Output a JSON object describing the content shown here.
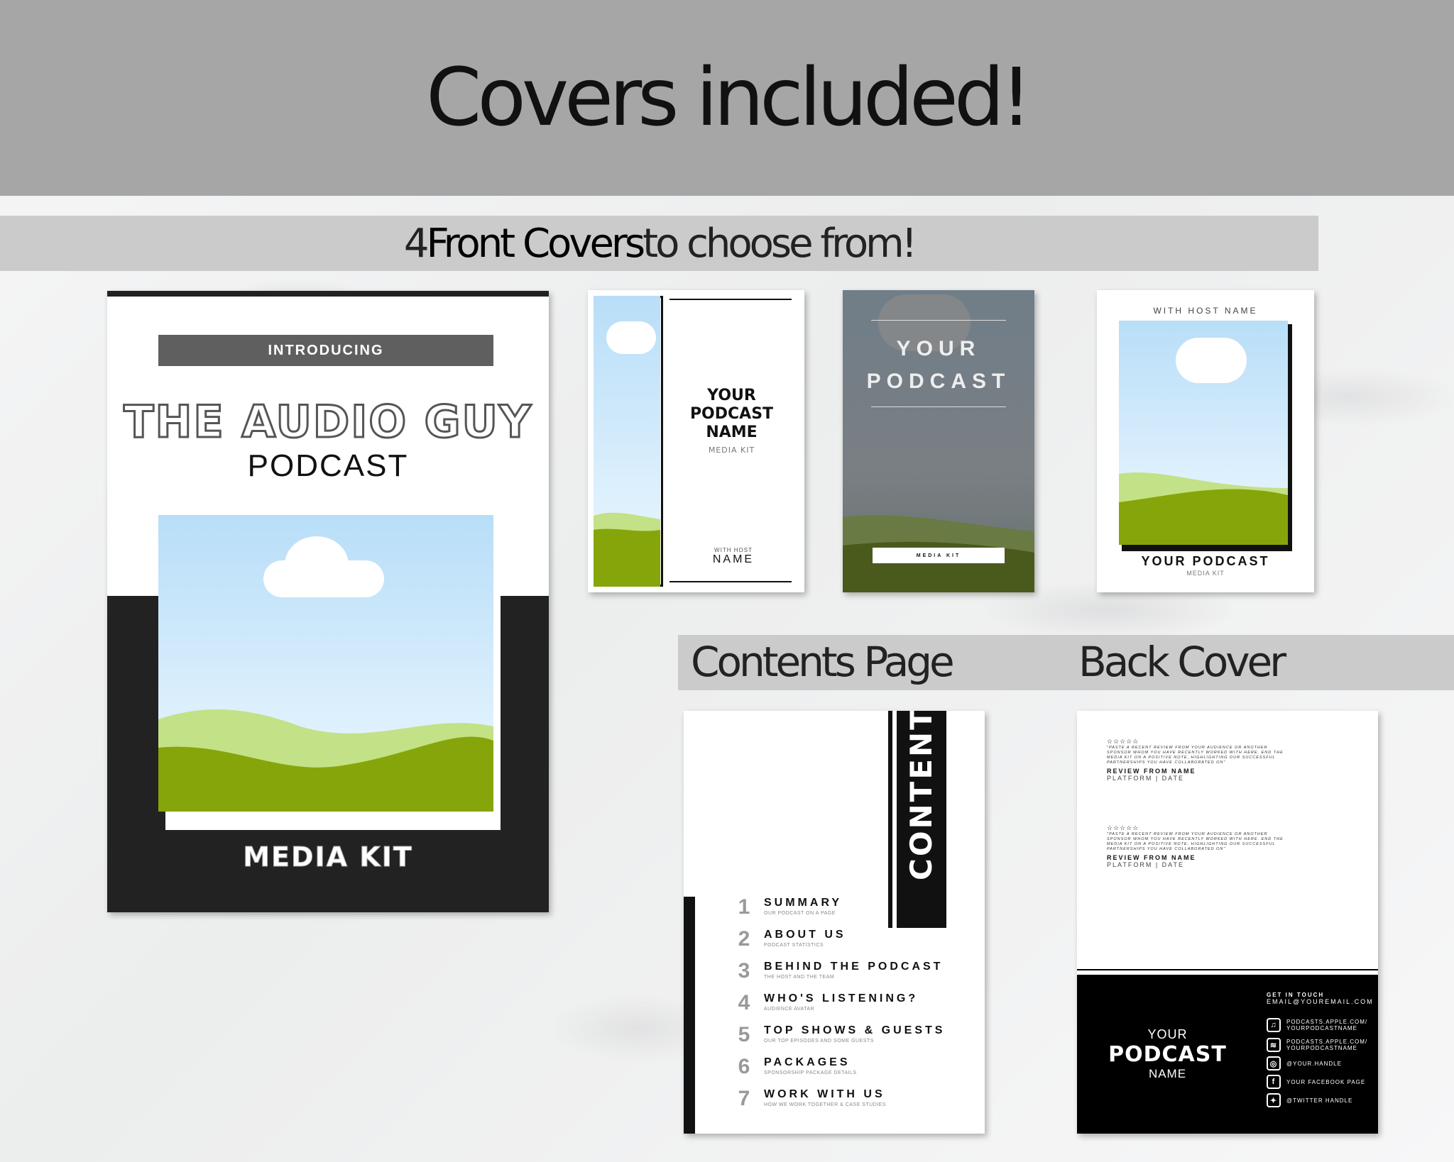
{
  "header": {
    "title": "Covers included!"
  },
  "front_band": {
    "prefix": "4 ",
    "bold": "Front Covers",
    "suffix": " to choose from!"
  },
  "lower_band": {
    "contents_label": "Contents Page",
    "back_label": "Back Cover"
  },
  "cover_main": {
    "introducing": "INTRODUCING",
    "title": "THE AUDIO GUY",
    "subtitle": "PODCAST",
    "footer": "MEDIA KIT"
  },
  "cover2": {
    "line1": "YOUR",
    "line2": "PODCAST",
    "line3": "NAME",
    "kit": "MEDIA KIT",
    "host_label": "WITH HOST",
    "host_name": "NAME"
  },
  "cover3": {
    "line1": "YOUR",
    "line2": "PODCAST",
    "kit": "MEDIA KIT"
  },
  "cover4": {
    "host": "WITH HOST NAME",
    "title": "YOUR PODCAST",
    "kit": "MEDIA KIT"
  },
  "contents": {
    "vertical_title": "CONTENTS",
    "items": [
      {
        "num": "1",
        "title": "SUMMARY",
        "sub": "OUR PODCAST ON A PAGE"
      },
      {
        "num": "2",
        "title": "ABOUT US",
        "sub": "PODCAST STATISTICS"
      },
      {
        "num": "3",
        "title": "BEHIND THE PODCAST",
        "sub": "THE HOST AND THE TEAM"
      },
      {
        "num": "4",
        "title": "WHO'S LISTENING?",
        "sub": "AUDIENCE AVATAR"
      },
      {
        "num": "5",
        "title": "TOP SHOWS & GUESTS",
        "sub": "OUR TOP EPISODES AND SOME GUESTS"
      },
      {
        "num": "6",
        "title": "PACKAGES",
        "sub": "SPONSORSHIP PACKAGE DETAILS"
      },
      {
        "num": "7",
        "title": "WORK WITH US",
        "sub": "HOW WE WORK TOGETHER & CASE STUDIES"
      }
    ]
  },
  "back": {
    "reviews": [
      {
        "stars": "☆☆☆☆☆",
        "quote": "\"PASTE A RECENT REVIEW FROM YOUR AUDIENCE OR ANOTHER SPONSOR WHOM YOU HAVE RECENTLY WORKED WITH HERE. END THE MEDIA KIT ON A POSITIVE NOTE, HIGHLIGHTING OUR SUCCESSFUL PARTNERSHIPS YOU HAVE COLLABORATED ON\"",
        "from": "REVIEW FROM NAME",
        "platform": "PLATFORM | DATE"
      },
      {
        "stars": "☆☆☆☆☆",
        "quote": "\"PASTE A RECENT REVIEW FROM YOUR AUDIENCE OR ANOTHER SPONSOR WHOM YOU HAVE RECENTLY WORKED WITH HERE. END THE MEDIA KIT ON A POSITIVE NOTE, HIGHLIGHTING OUR SUCCESSFUL PARTNERSHIPS YOU HAVE COLLABORATED ON\"",
        "from": "REVIEW FROM NAME",
        "platform": "PLATFORM | DATE"
      }
    ],
    "your": "YOUR",
    "podcast": "PODCAST",
    "name": "NAME",
    "get_in_touch": "GET IN TOUCH",
    "email": "EMAIL@YOUREMAIL.COM",
    "social": [
      {
        "icon": "podcast-icon",
        "glyph": "♫",
        "text": "PODCASTS.APPLE.COM/ YOURPODCASTNAME"
      },
      {
        "icon": "spotify-icon",
        "glyph": "≋",
        "text": "PODCASTS.APPLE.COM/ YOURPODCASTNAME"
      },
      {
        "icon": "instagram-icon",
        "glyph": "◎",
        "text": "@YOUR.HANDLE"
      },
      {
        "icon": "facebook-icon",
        "glyph": "f",
        "text": "YOUR FACEBOOK PAGE"
      },
      {
        "icon": "twitter-icon",
        "glyph": "✦",
        "text": "@TWITTER HANDLE"
      }
    ]
  }
}
